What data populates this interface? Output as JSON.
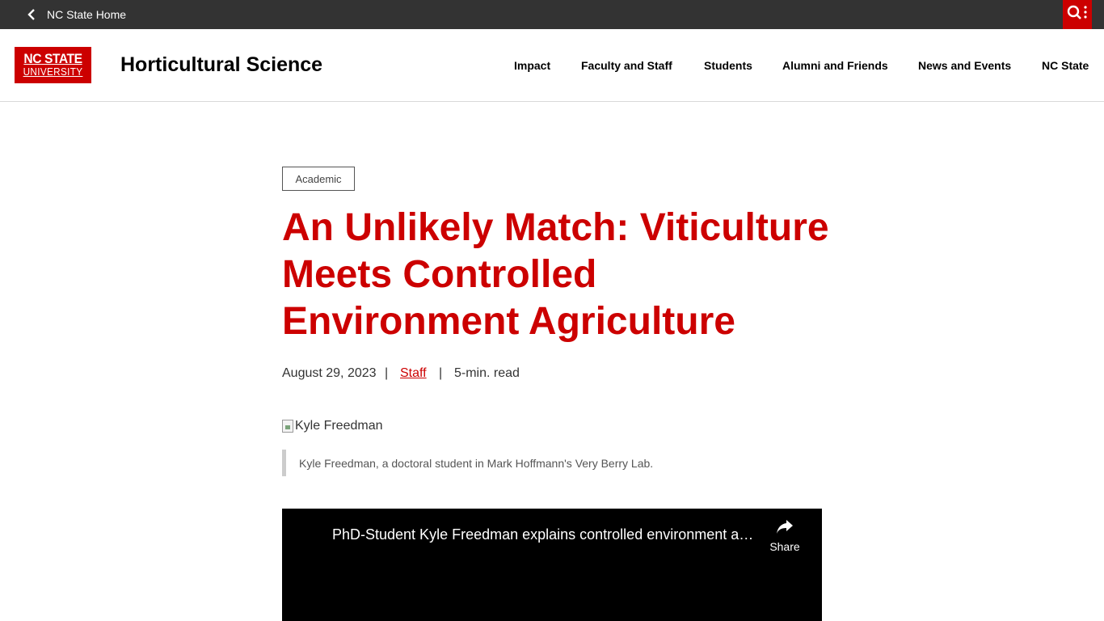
{
  "topbar": {
    "home_link": "NC State Home",
    "search_icon": "search-icon",
    "background": "#333333",
    "accent": "#cc0000"
  },
  "header": {
    "logo": {
      "line1": "NC STATE",
      "line2": "UNIVERSITY"
    },
    "site_title": "Horticultural Science",
    "nav": [
      "Impact",
      "Faculty and Staff",
      "Students",
      "Alumni and Friends",
      "News and Events",
      "NC State"
    ]
  },
  "article": {
    "category": "Academic",
    "headline": "An Unlikely Match: Viticulture Meets Controlled Environment Agriculture",
    "date": "August 29, 2023",
    "separator": "|",
    "author": "Staff",
    "read_time": "5-min. read",
    "image_alt": "Kyle Freedman",
    "caption": "Kyle Freedman, a doctoral student in Mark Hoffmann's Very Berry Lab.",
    "video": {
      "title": "PhD-Student Kyle Freedman explains controlled environment agriculture",
      "share_label": "Share",
      "share_icon": "share-icon"
    }
  },
  "colors": {
    "brand_red": "#cc0000",
    "text": "#222222"
  }
}
